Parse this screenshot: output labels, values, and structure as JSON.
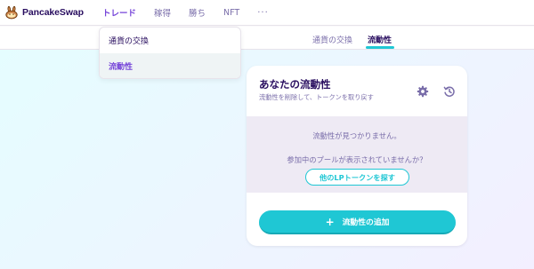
{
  "nav": {
    "brand": "PancakeSwap",
    "links": [
      "トレード",
      "稼得",
      "勝ち",
      "NFT"
    ],
    "more": "···"
  },
  "dropdown": {
    "items": [
      "通貨の交換",
      "流動性"
    ]
  },
  "subnav": {
    "tabs": [
      "通貨の交換",
      "流動性"
    ]
  },
  "card": {
    "title": "あなたの流動性",
    "subtitle": "流動性を削除して、トークンを取り戻す",
    "no_liquidity": "流動性が見つかりません。",
    "missing_pools": "参加中のプールが表示されていませんか？",
    "find_button": "他のLPトークンを探す",
    "add_button": "流動性の追加",
    "add_icon": "+"
  },
  "icons": {
    "logo": "bunny-logo-icon",
    "settings": "gear-icon",
    "history": "history-icon"
  },
  "colors": {
    "primary": "#1fc7d4",
    "secondary": "#7645d9",
    "text": "#280d5f",
    "text_subtle": "#7a6eaa"
  }
}
